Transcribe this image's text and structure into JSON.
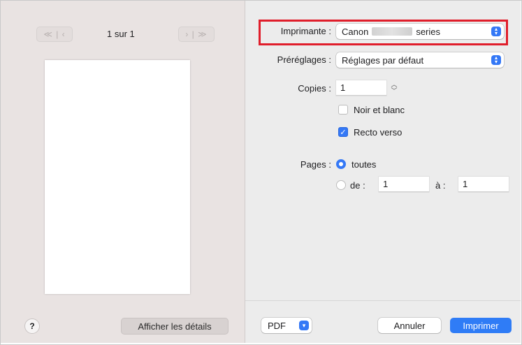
{
  "preview": {
    "first_prev_label": "≪ | ‹",
    "next_last_label": "› | ≫",
    "page_indicator": "1 sur 1",
    "help_label": "?",
    "details_button": "Afficher les détails"
  },
  "settings": {
    "printer": {
      "label": "Imprimante :",
      "value_prefix": "Canon",
      "value_suffix": "series"
    },
    "presets": {
      "label": "Préréglages :",
      "value": "Réglages par défaut"
    },
    "copies": {
      "label": "Copies :",
      "value": "1"
    },
    "black_white": {
      "label": "Noir et blanc",
      "checked": false
    },
    "duplex": {
      "label": "Recto verso",
      "checked": true
    },
    "pages": {
      "label": "Pages :",
      "all_label": "toutes",
      "range_label": "de :",
      "from": "1",
      "to_label": "à :",
      "to": "1",
      "selected": "all"
    }
  },
  "footer": {
    "pdf_label": "PDF",
    "cancel_label": "Annuler",
    "print_label": "Imprimer"
  },
  "colors": {
    "accent": "#3478f6",
    "highlight": "#e01e2b",
    "left_panel": "#e9e3e2",
    "right_panel": "#ececec"
  }
}
